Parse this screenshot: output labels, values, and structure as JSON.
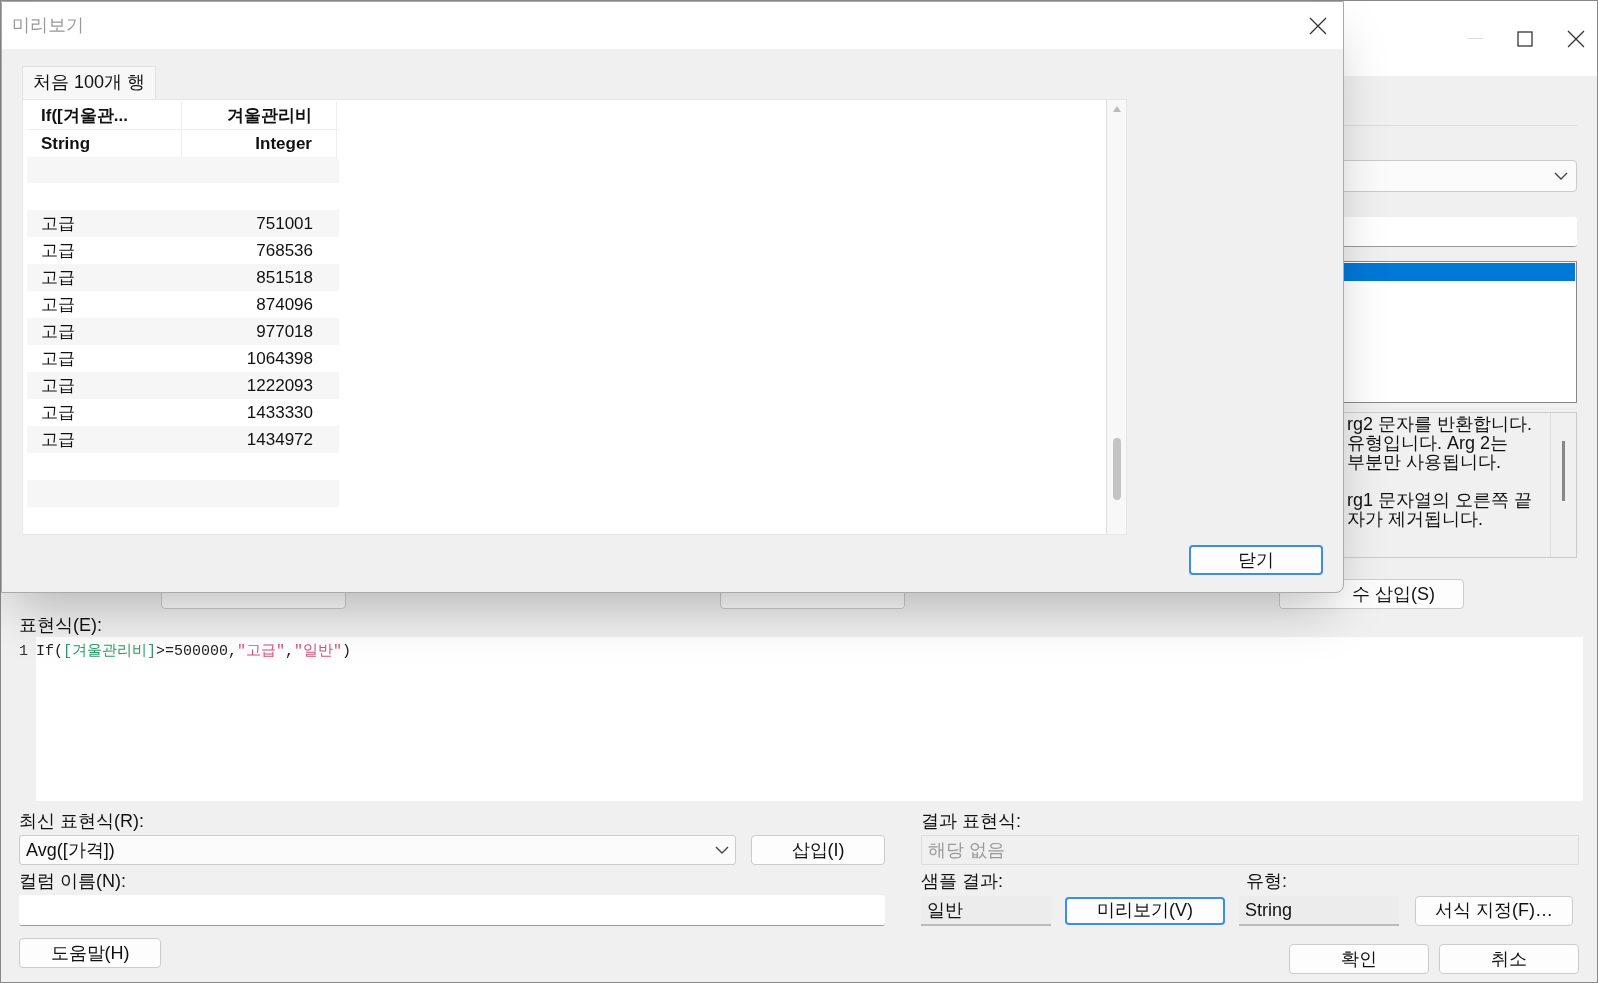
{
  "main_window": {
    "description_paragraphs": [
      [
        "rg2 문자를 반환합니다.",
        "유형입니다. Arg 2는",
        "부분만 사용됩니다."
      ],
      [
        "rg1 문자열의 오른쪽 끝",
        "자가 제거됩니다."
      ]
    ],
    "function_insert_button": "수 삽입(S)",
    "expression_label": "표현식(E):",
    "code": [
      {
        "kind": "plain",
        "text": "If("
      },
      {
        "kind": "field",
        "text": "[겨울관리비]"
      },
      {
        "kind": "plain",
        "text": ">=500000,"
      },
      {
        "kind": "string",
        "text": "\"고급\""
      },
      {
        "kind": "plain",
        "text": ","
      },
      {
        "kind": "string",
        "text": "\"일반\""
      },
      {
        "kind": "plain",
        "text": ")"
      }
    ],
    "line_number": "1",
    "recent_label": "최신 표현식(R):",
    "recent_value": "Avg([가격])",
    "insert_button": "삽입(I)",
    "column_name_label": "컬럼 이름(N):",
    "help_button": "도움말(H)",
    "result_label": "결과 표현식:",
    "result_value": "해당 없음",
    "sample_label": "샘플 결과:",
    "sample_value": "일반",
    "preview_button": "미리보기(V)",
    "type_label": "유형:",
    "type_value": "String",
    "format_button": "서식 지정(F)…",
    "ok_button": "확인",
    "cancel_button": "취소"
  },
  "preview_dialog": {
    "title": "미리보기",
    "tab": {
      "label": "처음 100개 행",
      "selected": true
    },
    "columns": [
      {
        "header": "If([겨울관...",
        "type": "String"
      },
      {
        "header": "겨울관리비",
        "type": "Integer"
      }
    ],
    "rows": [
      [
        "고급",
        "751001"
      ],
      [
        "고급",
        "768536"
      ],
      [
        "고급",
        "851518"
      ],
      [
        "고급",
        "874096"
      ],
      [
        "고급",
        "977018"
      ],
      [
        "고급",
        "1064398"
      ],
      [
        "고급",
        "1222093"
      ],
      [
        "고급",
        "1433330"
      ],
      [
        "고급",
        "1434972"
      ]
    ],
    "close_button": "닫기"
  }
}
